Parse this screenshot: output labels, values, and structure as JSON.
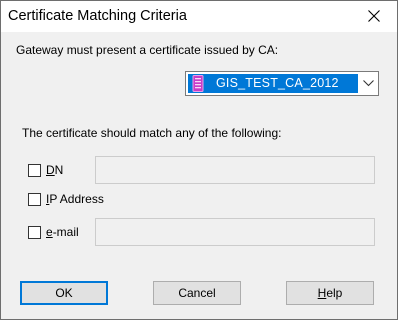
{
  "window": {
    "title": "Certificate Matching Criteria"
  },
  "ca": {
    "label": "Gateway must present a certificate issued by CA:",
    "selected": "GIS_TEST_CA_2012",
    "icon": "certificate-icon"
  },
  "match": {
    "label": "The certificate should match any of the following:",
    "dn": {
      "label_ul": "D",
      "label_rest": "N",
      "checked": false,
      "value": ""
    },
    "ip": {
      "label_ul": "I",
      "label_rest": "P Address",
      "checked": false
    },
    "email": {
      "label_ul": "e",
      "label_rest": "-mail",
      "checked": false,
      "value": ""
    }
  },
  "buttons": {
    "ok": "OK",
    "cancel": "Cancel",
    "help_ul": "H",
    "help_rest": "elp"
  },
  "colors": {
    "selection": "#0078d7",
    "dialog_bg": "#f0f0f0",
    "cert_icon": "#c83cc8"
  }
}
